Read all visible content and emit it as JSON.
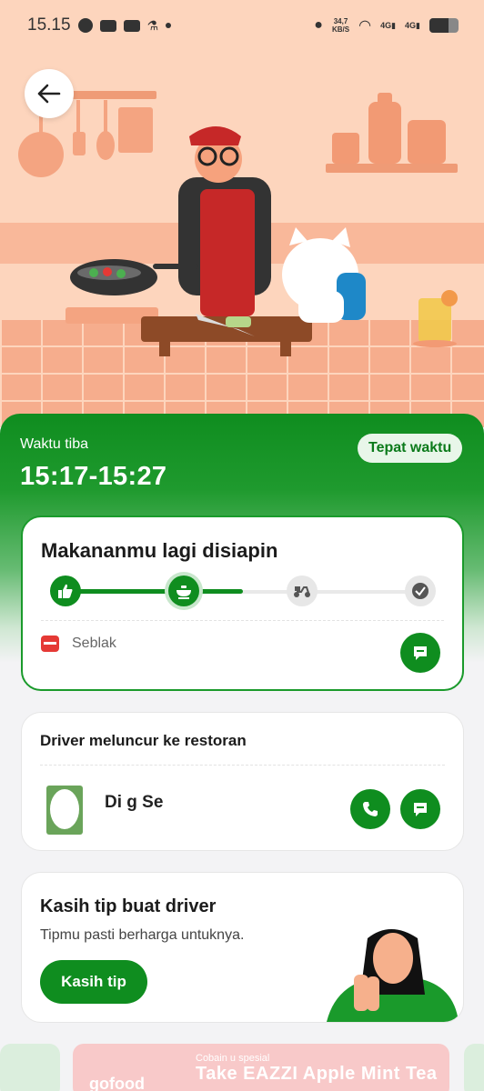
{
  "status_bar": {
    "time": "15.15",
    "net_speed_value": "34,7",
    "net_speed_unit": "KB/S",
    "sig1": "4G",
    "sig2": "4G",
    "battery_level": 0.65
  },
  "header": {
    "eta_label": "Waktu tiba",
    "eta_time": "15:17-15:27",
    "badge": "Tepat waktu"
  },
  "status_card": {
    "title": "Makananmu lagi disiapin",
    "steps": [
      "thumbs-up-icon",
      "cooking-icon",
      "scooter-icon",
      "check-icon"
    ],
    "progress_fraction": 0.5,
    "order_item": "Seblak"
  },
  "driver_card": {
    "title": "Driver meluncur ke restoran",
    "driver_name": "Di                              g Se"
  },
  "tip_card": {
    "title": "Kasih tip buat driver",
    "subtitle": "Tipmu pasti berharga untuknya.",
    "button": "Kasih tip"
  },
  "promo": {
    "logo": "gofood",
    "tag": "Cobain      u spesial",
    "title": "Take EAZZI Apple Mint Tea"
  },
  "colors": {
    "brand_green": "#0f8d1f",
    "hero_bg": "#fdd5bd"
  }
}
